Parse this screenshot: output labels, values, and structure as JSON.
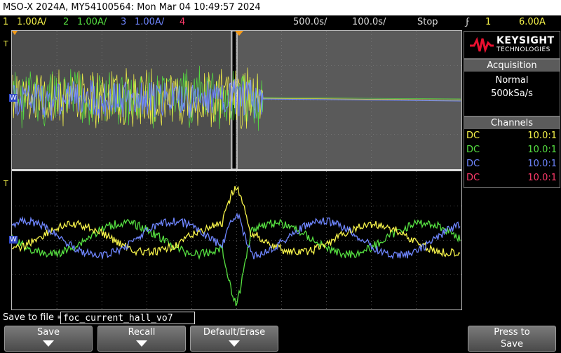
{
  "window": {
    "title": "MSO-X 2024A, MY54100564: Mon Mar 04 10:49:57 2024"
  },
  "status": {
    "channels": [
      {
        "num": "1",
        "scale": "1.00A/",
        "color": "#f6f34a"
      },
      {
        "num": "2",
        "scale": "1.00A/",
        "color": "#56e041"
      },
      {
        "num": "3",
        "scale": "1.00A/",
        "color": "#6f86ff"
      },
      {
        "num": "4",
        "scale": "",
        "color": "#ff3a6a"
      }
    ],
    "timebase": "500.0s/",
    "delay": "100.0s/",
    "run_state": "Stop",
    "trigger_icon": "ϝ",
    "trigger_channel": "1",
    "trigger_level": "6.00A"
  },
  "brand": {
    "name": "KEYSIGHT",
    "sub": "TECHNOLOGIES",
    "accent": "#e8102f"
  },
  "acquisition": {
    "title": "Acquisition",
    "mode": "Normal",
    "rate": "500kSa/s"
  },
  "channels_panel": {
    "title": "Channels",
    "rows": [
      {
        "coupling": "DC",
        "probe": "10.0:1",
        "color": "#f6f34a"
      },
      {
        "coupling": "DC",
        "probe": "10.0:1",
        "color": "#56e041"
      },
      {
        "coupling": "DC",
        "probe": "10.0:1",
        "color": "#6f86ff"
      },
      {
        "coupling": "DC",
        "probe": "10.0:1",
        "color": "#ff3a6a"
      }
    ]
  },
  "display": {
    "upper_label": "W",
    "lower_label": "W",
    "marker_t": "T"
  },
  "save": {
    "label": "Save to file =",
    "filename": "foc_current_hall_vo7"
  },
  "softkeys": {
    "save": "Save",
    "recall": "Recall",
    "default_erase": "Default/Erase",
    "press_to_save_1": "Press to",
    "press_to_save_2": "Save"
  }
}
